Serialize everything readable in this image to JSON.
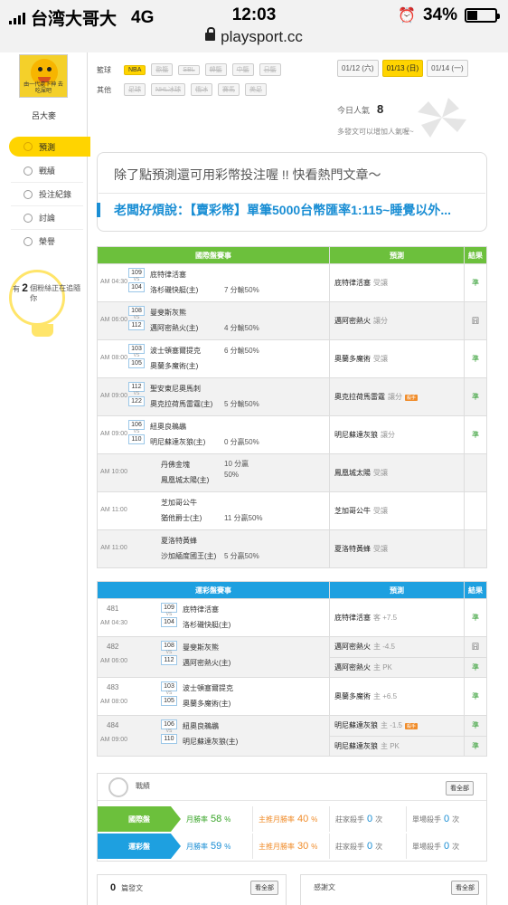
{
  "status_bar": {
    "carrier": "台湾大哥大",
    "network": "4G",
    "time": "12:03",
    "battery": "34%",
    "url": "playsport.cc"
  },
  "sidebar": {
    "avatar_caption": "由一代處下神 去吃屎吧",
    "username": "呂大麥",
    "menu": [
      {
        "label": "預測",
        "icon": "target-icon",
        "active": true
      },
      {
        "label": "戰績",
        "icon": "chat-icon",
        "active": false
      },
      {
        "label": "投注紀錄",
        "icon": "circle-icon",
        "active": false
      },
      {
        "label": "討論",
        "icon": "edit-icon",
        "active": false
      },
      {
        "label": "榮譽",
        "icon": "medal-icon",
        "active": false
      }
    ],
    "bulb": {
      "prefix": "有",
      "count": "2",
      "suffix": "個粉絲正在追隨你"
    }
  },
  "filters": {
    "rows": [
      {
        "label": "籃球",
        "tags": [
          "NBA",
          "歐籃",
          "SBL",
          "韓籃",
          "中籃",
          "日籃"
        ],
        "selected": 0
      },
      {
        "label": "其他",
        "tags": [
          "足球",
          "NHL冰球",
          "俄冰",
          "賽馬",
          "美足"
        ],
        "selected": -1
      }
    ],
    "dates": [
      "01/12 (六)",
      "01/13 (日)",
      "01/14 (一)"
    ],
    "selected_date": 1
  },
  "popularity": {
    "label": "今日人氣",
    "value": "8",
    "tip": "多發文可以增加人氣喔~"
  },
  "banner": {
    "line1": "除了點預測還可用彩幣投注喔 !! 快看熱門文章～",
    "line2": "老闆好煩說：【賣彩幣】單筆5000台幣匯率1:115~睡覺以外..."
  },
  "intl_table": {
    "headers": [
      "國際盤賽事",
      "預測",
      "結果"
    ],
    "rows": [
      {
        "time": "AM 04:30",
        "num_a": "109",
        "num_b": "104",
        "team_a": "底特律活塞",
        "team_b": "洛杉磯快艇(主)",
        "handicap": "7 分輸50%",
        "hc_row": "b",
        "pick": "底特律活塞",
        "pick_type": "受讓",
        "hot": "",
        "result": "準",
        "alt": false
      },
      {
        "time": "AM 06:00",
        "num_a": "108",
        "num_b": "112",
        "team_a": "曼斐斯灰熊",
        "team_b": "邁阿密熱火(主)",
        "handicap": "4 分輸50%",
        "hc_row": "b",
        "pick": "邁阿密熱火",
        "pick_type": "讓分",
        "hot": "",
        "result": "囧",
        "alt": true
      },
      {
        "time": "AM 08:00",
        "num_a": "103",
        "num_b": "105",
        "team_a": "波士頓塞爾提克",
        "team_b": "奧蘭多魔術(主)",
        "handicap": "6 分輸50%",
        "hc_row": "a",
        "pick": "奧蘭多魔術",
        "pick_type": "受讓",
        "hot": "",
        "result": "準",
        "alt": false
      },
      {
        "time": "AM 09:00",
        "num_a": "112",
        "num_b": "122",
        "team_a": "聖安東尼奧馬刺",
        "team_b": "奧克拉荷馬雷霆(主)",
        "handicap": "5 分輸50%",
        "hc_row": "b",
        "pick": "奧克拉荷馬雷霆",
        "pick_type": "讓分",
        "hot": "殺手",
        "result": "準",
        "alt": true
      },
      {
        "time": "AM 09:00",
        "num_a": "106",
        "num_b": "110",
        "team_a": "紐奧良鵜鶘",
        "team_b": "明尼蘇達灰狼(主)",
        "handicap": "0 分贏50%",
        "hc_row": "b",
        "pick": "明尼蘇達灰狼",
        "pick_type": "讓分",
        "hot": "",
        "result": "準",
        "alt": false
      },
      {
        "time": "AM 10:00",
        "num_a": "",
        "num_b": "",
        "team_a": "丹佛金塊",
        "team_b": "鳳凰城太陽(主)",
        "handicap": "10 分贏 50%",
        "hc_row": "a",
        "pick": "鳳凰城太陽",
        "pick_type": "受讓",
        "hot": "",
        "result": "",
        "alt": true
      },
      {
        "time": "AM 11:00",
        "num_a": "",
        "num_b": "",
        "team_a": "芝加哥公牛",
        "team_b": "猶他爵士(主)",
        "handicap": "11 分贏50%",
        "hc_row": "b",
        "pick": "芝加哥公牛",
        "pick_type": "受讓",
        "hot": "",
        "result": "",
        "alt": false
      },
      {
        "time": "AM 11:00",
        "num_a": "",
        "num_b": "",
        "team_a": "夏洛特黃蜂",
        "team_b": "沙加緬度國王(主)",
        "handicap": "5 分贏50%",
        "hc_row": "b",
        "pick": "夏洛特黃蜂",
        "pick_type": "受讓",
        "hot": "",
        "result": "",
        "alt": true
      }
    ]
  },
  "lottery_table": {
    "headers": [
      "運彩盤賽事",
      "預測",
      "結果"
    ],
    "rows": [
      {
        "code": "481",
        "time": "AM 04:30",
        "num_a": "109",
        "num_b": "104",
        "team_a": "底特律活塞",
        "team_b": "洛杉磯快艇(主)",
        "picks": [
          {
            "pick": "底特律活塞",
            "type": "客 +7.5",
            "hot": "",
            "result": "準"
          }
        ],
        "alt": false
      },
      {
        "code": "482",
        "time": "AM 06:00",
        "num_a": "108",
        "num_b": "112",
        "team_a": "曼斐斯灰熊",
        "team_b": "邁阿密熱火(主)",
        "picks": [
          {
            "pick": "邁阿密熱火",
            "type": "主 -4.5",
            "hot": "",
            "result": "囧"
          },
          {
            "pick": "邁阿密熱火",
            "type": "主 PK",
            "hot": "",
            "result": "準"
          }
        ],
        "alt": true
      },
      {
        "code": "483",
        "time": "AM 08:00",
        "num_a": "103",
        "num_b": "105",
        "team_a": "波士頓塞爾提克",
        "team_b": "奧蘭多魔術(主)",
        "picks": [
          {
            "pick": "奧蘭多魔術",
            "type": "主 +6.5",
            "hot": "",
            "result": "準"
          }
        ],
        "alt": false
      },
      {
        "code": "484",
        "time": "AM 09:00",
        "num_a": "106",
        "num_b": "110",
        "team_a": "紐奧良鵜鶘",
        "team_b": "明尼蘇達灰狼(主)",
        "picks": [
          {
            "pick": "明尼蘇達灰狼",
            "type": "主 -1.5",
            "hot": "殺手",
            "result": "準"
          },
          {
            "pick": "明尼蘇達灰狼",
            "type": "主 PK",
            "hot": "",
            "result": "準"
          }
        ],
        "alt": true
      }
    ]
  },
  "stats": {
    "title": "戰績",
    "see_all": "看全部",
    "rows": [
      {
        "label": "國際盤",
        "color": "#6cc03c",
        "month_label": "月勝率",
        "month_val": "58",
        "main_label": "主推月勝率",
        "main_val": "40",
        "dealer_label": "莊家殺手",
        "dealer_val": "0",
        "single_label": "單場殺手",
        "single_val": "0"
      },
      {
        "label": "運彩盤",
        "color": "#1ea0e0",
        "month_label": "月勝率",
        "month_val": "59",
        "main_label": "主推月勝率",
        "main_val": "30",
        "dealer_label": "莊家殺手",
        "dealer_val": "0",
        "single_label": "單場殺手",
        "single_val": "0"
      }
    ],
    "pct": "%",
    "times": "次"
  },
  "bottom": {
    "left_count": "0",
    "left_label": "篇發文",
    "left_btn": "看全部",
    "right_label": "感謝文",
    "right_btn": "看全部"
  }
}
